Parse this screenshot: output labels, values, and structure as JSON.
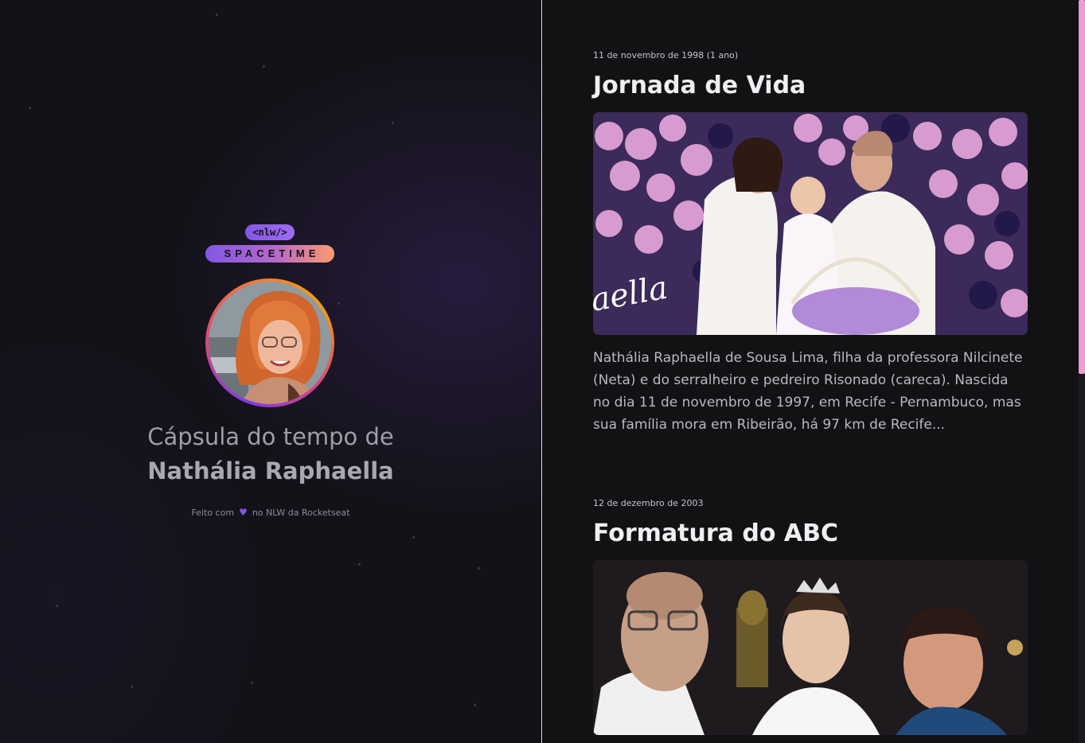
{
  "brand": {
    "tag": "<nlw/>",
    "name": "SPACETIME"
  },
  "profile": {
    "capsule_prefix": "Cápsula do tempo de",
    "name": "Nathália Raphaella"
  },
  "footer": {
    "made_with": "Feito com",
    "by": "no NLW da Rocketseat"
  },
  "memories": [
    {
      "date": "11 de novembro de 1998 (1 ano)",
      "title": "Jornada de Vida",
      "excerpt": "Nathália Raphaella de Sousa Lima, filha da professora Nilcinete (Neta) e do serralheiro e pedreiro Risonado (careca). Nascida no dia 11 de novembro de 1997, em Recife - Pernambuco, mas sua família mora em Ribeirão, há 97 km de Recife..."
    },
    {
      "date": "12 de dezembro de 2003",
      "title": "Formatura do ABC"
    }
  ],
  "colors": {
    "background": "#121215",
    "accent_purple": "#8257e5",
    "accent_orange": "#ff9a6b",
    "scrollbar_thumb": "#e6a0d6"
  },
  "icons": [
    "heart-icon"
  ]
}
